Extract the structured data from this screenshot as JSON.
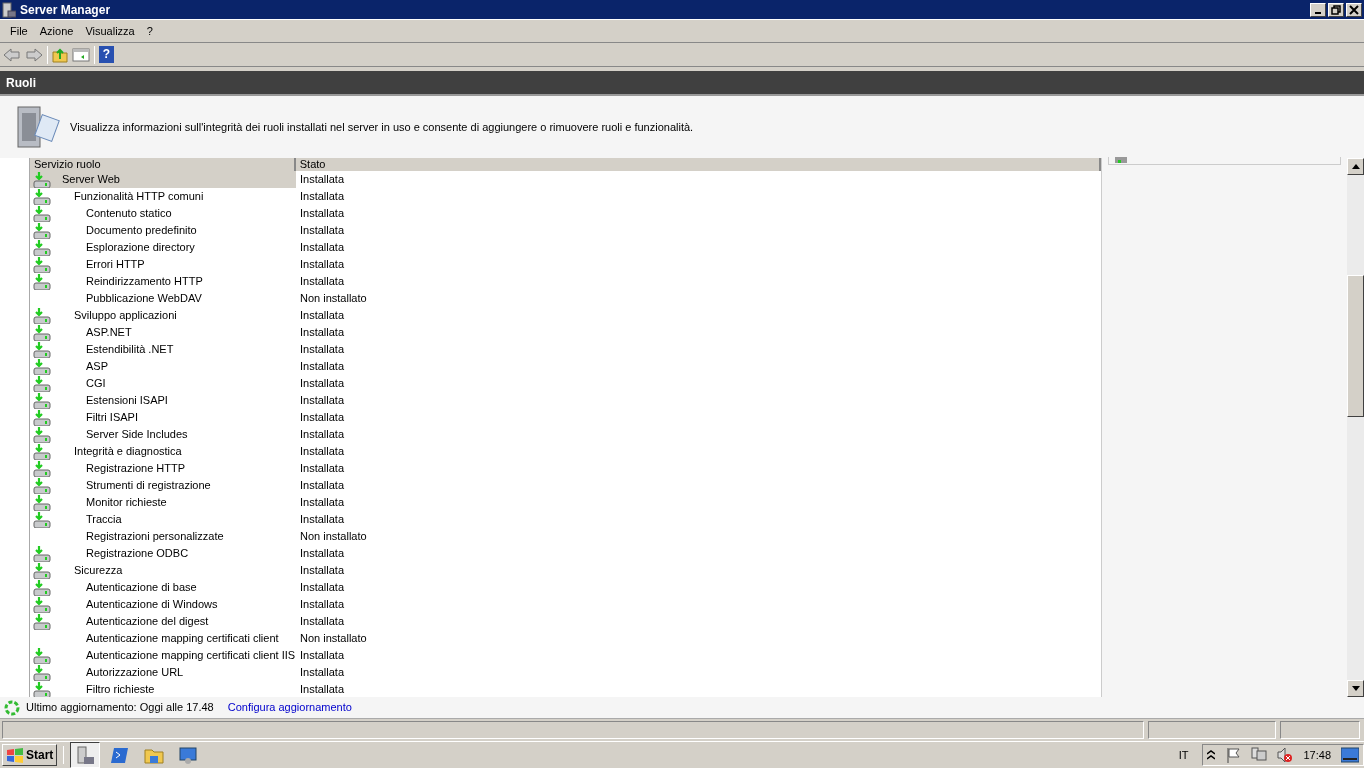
{
  "window": {
    "title": "Server Manager"
  },
  "menu": [
    "File",
    "Azione",
    "Visualizza",
    "?"
  ],
  "toolbar": {
    "help": "?"
  },
  "section": {
    "title": "Ruoli",
    "description": "Visualizza informazioni sull'integrità dei ruoli installati nel server in uso e consente di aggiungere o rimuovere ruoli e funzionalità."
  },
  "table": {
    "columns": [
      "Servizio ruolo",
      "Stato"
    ],
    "rows": [
      {
        "name": "Server Web",
        "status": "Installata",
        "installed": true,
        "selected": true,
        "children": [
          {
            "name": "Funzionalità HTTP comuni",
            "status": "Installata",
            "installed": true,
            "selected": false,
            "children": [
              {
                "name": "Contenuto statico",
                "status": "Installata",
                "installed": true,
                "selected": false
              },
              {
                "name": "Documento predefinito",
                "status": "Installata",
                "installed": true,
                "selected": false
              },
              {
                "name": "Esplorazione directory",
                "status": "Installata",
                "installed": true,
                "selected": false
              },
              {
                "name": "Errori HTTP",
                "status": "Installata",
                "installed": true,
                "selected": false
              },
              {
                "name": "Reindirizzamento HTTP",
                "status": "Installata",
                "installed": true,
                "selected": false
              },
              {
                "name": "Pubblicazione WebDAV",
                "status": "Non installato",
                "installed": false,
                "selected": false
              }
            ]
          },
          {
            "name": "Sviluppo applicazioni",
            "status": "Installata",
            "installed": true,
            "selected": false,
            "children": [
              {
                "name": "ASP.NET",
                "status": "Installata",
                "installed": true,
                "selected": false
              },
              {
                "name": "Estendibilità .NET",
                "status": "Installata",
                "installed": true,
                "selected": false
              },
              {
                "name": "ASP",
                "status": "Installata",
                "installed": true,
                "selected": false
              },
              {
                "name": "CGI",
                "status": "Installata",
                "installed": true,
                "selected": false
              },
              {
                "name": "Estensioni ISAPI",
                "status": "Installata",
                "installed": true,
                "selected": false
              },
              {
                "name": "Filtri ISAPI",
                "status": "Installata",
                "installed": true,
                "selected": false
              },
              {
                "name": "Server Side Includes",
                "status": "Installata",
                "installed": true,
                "selected": false
              }
            ]
          },
          {
            "name": "Integrità e diagnostica",
            "status": "Installata",
            "installed": true,
            "selected": false,
            "children": [
              {
                "name": "Registrazione HTTP",
                "status": "Installata",
                "installed": true,
                "selected": false
              },
              {
                "name": "Strumenti di registrazione",
                "status": "Installata",
                "installed": true,
                "selected": false
              },
              {
                "name": "Monitor richieste",
                "status": "Installata",
                "installed": true,
                "selected": false
              },
              {
                "name": "Traccia",
                "status": "Installata",
                "installed": true,
                "selected": false
              },
              {
                "name": "Registrazioni personalizzate",
                "status": "Non installato",
                "installed": false,
                "selected": false
              },
              {
                "name": "Registrazione ODBC",
                "status": "Installata",
                "installed": true,
                "selected": false
              }
            ]
          },
          {
            "name": "Sicurezza",
            "status": "Installata",
            "installed": true,
            "selected": false,
            "children": [
              {
                "name": "Autenticazione di base",
                "status": "Installata",
                "installed": true,
                "selected": false
              },
              {
                "name": "Autenticazione di Windows",
                "status": "Installata",
                "installed": true,
                "selected": false
              },
              {
                "name": "Autenticazione del digest",
                "status": "Installata",
                "installed": true,
                "selected": false
              },
              {
                "name": "Autenticazione mapping certificati client",
                "status": "Non installato",
                "installed": false,
                "selected": false
              },
              {
                "name": "Autenticazione mapping certificati client IIS",
                "status": "Installata",
                "installed": true,
                "selected": false
              },
              {
                "name": "Autorizzazione URL",
                "status": "Installata",
                "installed": true,
                "selected": false
              },
              {
                "name": "Filtro richieste",
                "status": "Installata",
                "installed": true,
                "selected": false
              }
            ]
          }
        ]
      }
    ]
  },
  "refresh": {
    "text": "Ultimo aggiornamento: Oggi alle 17.48",
    "link": "Configura aggiornamento"
  },
  "taskbar": {
    "start": "Start",
    "language": "IT",
    "clock": "17:48"
  }
}
